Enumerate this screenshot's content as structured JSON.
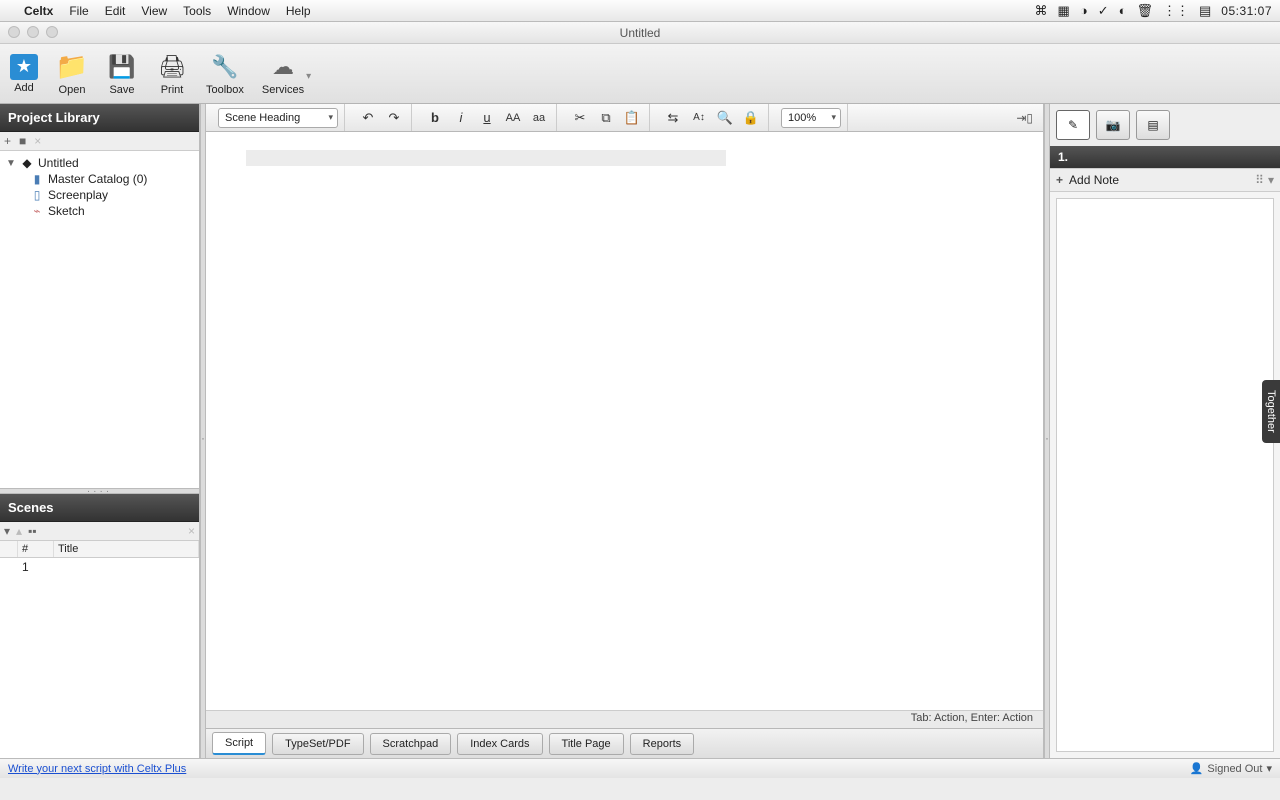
{
  "menubar": {
    "app": "Celtx",
    "items": [
      "File",
      "Edit",
      "View",
      "Tools",
      "Window",
      "Help"
    ],
    "clock": "05:31:07"
  },
  "window": {
    "title": "Untitled"
  },
  "toolbar": {
    "add": "Add",
    "open": "Open",
    "save": "Save",
    "print": "Print",
    "toolbox": "Toolbox",
    "services": "Services"
  },
  "sidebar": {
    "library_title": "Project Library",
    "root": "Untitled",
    "items": [
      {
        "label": "Master Catalog (0)"
      },
      {
        "label": "Screenplay"
      },
      {
        "label": "Sketch"
      }
    ],
    "scenes_title": "Scenes",
    "scenes_cols": {
      "num": "#",
      "title": "Title"
    },
    "scenes": [
      {
        "num": "1",
        "title": ""
      }
    ]
  },
  "formatbar": {
    "element_type": "Scene Heading",
    "zoom": "100%"
  },
  "bottom_tabs": [
    "Script",
    "TypeSet/PDF",
    "Scratchpad",
    "Index Cards",
    "Title Page",
    "Reports"
  ],
  "hint": "Tab: Action, Enter: Action",
  "rightpanel": {
    "scene_num": "1.",
    "add_note": "Add Note"
  },
  "together": "Together",
  "footer": {
    "promo": "Write your next script with Celtx Plus",
    "signed": "Signed Out"
  }
}
